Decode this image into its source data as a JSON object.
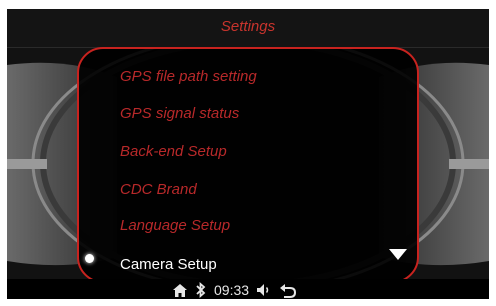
{
  "title": "Settings",
  "menu": {
    "items": [
      {
        "label": "GPS file path setting"
      },
      {
        "label": "GPS signal status"
      },
      {
        "label": "Back-end Setup"
      },
      {
        "label": "CDC Brand"
      },
      {
        "label": "Language Setup"
      },
      {
        "label": "Camera Setup"
      }
    ],
    "selected_index": 5
  },
  "status": {
    "time": "09:33",
    "icons": [
      "home-icon",
      "bluetooth-icon",
      "volume-icon",
      "back-icon"
    ]
  },
  "colors": {
    "accent": "#c8231f",
    "text_dim": "#b8292a",
    "text_selected": "#ffffff"
  }
}
